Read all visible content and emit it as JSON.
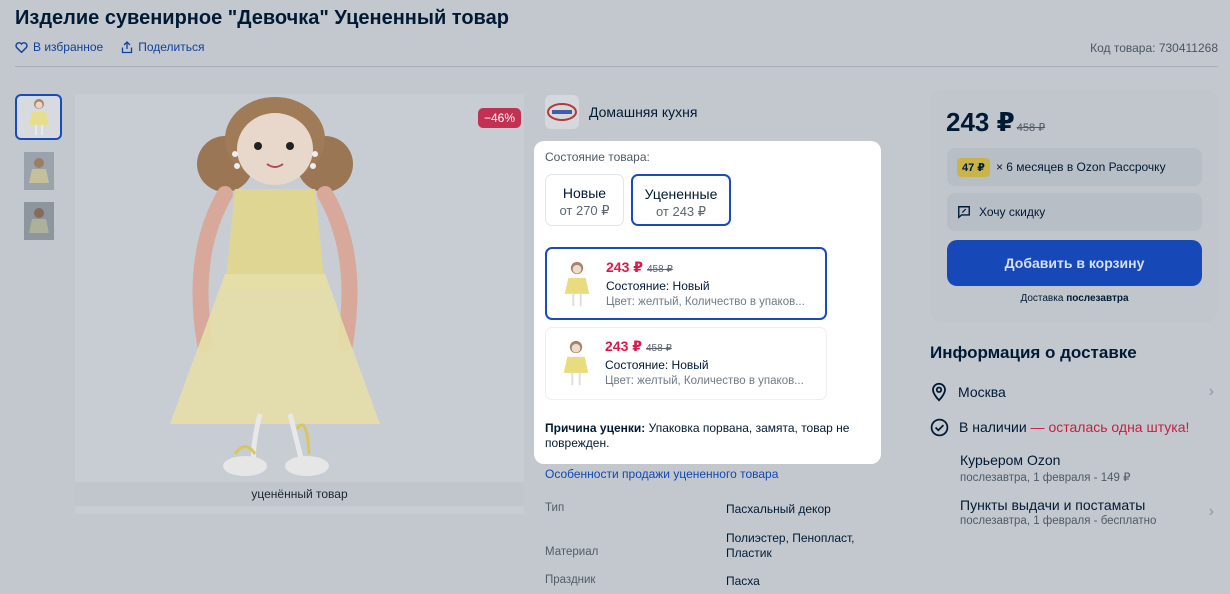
{
  "header": {
    "title": "Изделие сувенирное \"Девочка\" Уцененный товар",
    "favorite_label": "В избранное",
    "share_label": "Поделиться",
    "product_code": "Код товара: 730411268"
  },
  "gallery": {
    "discount_badge": "−46%",
    "image_label": "уценённый товар",
    "thumbnails": [
      "doll-thumb-1",
      "doll-thumb-2",
      "doll-thumb-3"
    ]
  },
  "seller": {
    "name": "Домашняя кухня",
    "logo_icon": "seller-logo-icon"
  },
  "condition_popup": {
    "label": "Состояние товара:",
    "options": [
      {
        "title": "Новые",
        "subtitle": "от 270 ₽"
      },
      {
        "title": "Уцененные",
        "subtitle": "от 243 ₽"
      }
    ],
    "offers": [
      {
        "price": "243 ₽",
        "old_price": "458 ₽",
        "condition": "Состояние: Новый",
        "color": "Цвет: желтый, Количество в упаков..."
      },
      {
        "price": "243 ₽",
        "old_price": "458 ₽",
        "condition": "Состояние: Новый",
        "color": "Цвет: желтый, Количество в упаков..."
      }
    ],
    "reason_label": "Причина уценки:",
    "reason_text": " Упаковка порвана, замята, товар не поврежден."
  },
  "specs": {
    "link": "Особенности продажи уцененного товара",
    "rows": [
      {
        "key": "Тип",
        "value": "Пасхальный декор"
      },
      {
        "key": "Материал",
        "value": "Полиэстер, Пенопласт, Пластик"
      },
      {
        "key": "Праздник",
        "value": "Пасха"
      }
    ]
  },
  "buybox": {
    "price": "243 ₽",
    "old_price": "458 ₽",
    "installment_tag": "47 ₽",
    "installment_text": "× 6 месяцев в Ozon Рассрочку",
    "discount_request": "Хочу скидку",
    "cart_button": "Добавить в корзину",
    "delivery_prefix": "Доставка ",
    "delivery_when": "послезавтра"
  },
  "delivery": {
    "title": "Информация о доставке",
    "city": "Москва",
    "stock_prefix": "В наличии",
    "stock_warning": " — осталась одна штука!",
    "courier_title": "Курьером Ozon",
    "courier_sub": "послезавтра, 1 февраля - 149 ₽",
    "pickup_title": "Пункты выдачи и постаматы",
    "pickup_sub": "послезавтра, 1 февраля - бесплатно"
  },
  "colors": {
    "accent": "#1a4bbd",
    "price_red": "#d9194c",
    "cart_button": "#1748b8"
  }
}
